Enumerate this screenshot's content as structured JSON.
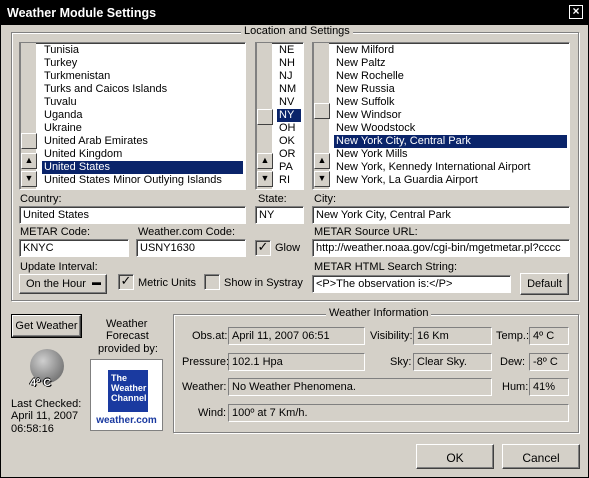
{
  "window": {
    "title": "Weather Module Settings",
    "close_glyph": "×"
  },
  "location": {
    "group_title": "Location and Settings",
    "countries": [
      "Tunisia",
      "Turkey",
      "Turkmenistan",
      "Turks and Caicos Islands",
      "Tuvalu",
      "Uganda",
      "Ukraine",
      "United Arab Emirates",
      "United Kingdom",
      "United States",
      "United States Minor Outlying Islands"
    ],
    "selected_country_index": 9,
    "states": [
      "NE",
      "NH",
      "NJ",
      "NM",
      "NV",
      "NY",
      "OH",
      "OK",
      "OR",
      "PA",
      "RI"
    ],
    "selected_state_index": 5,
    "cities": [
      "New Milford",
      "New Paltz",
      "New Rochelle",
      "New Russia",
      "New Suffolk",
      "New Windsor",
      "New Woodstock",
      "New York City, Central Park",
      "New York Mills",
      "New York, Kennedy International Airport",
      "New York, La Guardia Airport"
    ],
    "selected_city_index": 7,
    "country_label": "Country:",
    "country_value": "United States",
    "state_label": "State:",
    "state_value": "NY",
    "city_label": "City:",
    "city_value": "New York City, Central Park",
    "metar_code_label": "METAR Code:",
    "metar_code_value": "KNYC",
    "weather_com_code_label": "Weather.com Code:",
    "weather_com_code_value": "USNY1630",
    "glow_label": "Glow",
    "glow_checked": true,
    "metar_source_label": "METAR Source URL:",
    "metar_source_value": "http://weather.noaa.gov/cgi-bin/mgetmetar.pl?cccc",
    "update_interval_label": "Update Interval:",
    "update_interval_value": "On the Hour",
    "metric_units_label": "Metric Units",
    "metric_units_checked": true,
    "show_in_systray_label": "Show in Systray",
    "show_in_systray_checked": false,
    "metar_html_search_label": "METAR HTML Search String:",
    "metar_html_search_value": "<P>The observation is:</P>",
    "default_button": "Default"
  },
  "left_panel": {
    "get_weather_button": "Get Weather",
    "forecast_line1": "Weather",
    "forecast_line2": "Forecast",
    "forecast_line3": "provided by:",
    "logo_line1": "The",
    "logo_line2": "Weather",
    "logo_line3": "Channel",
    "logo_url": "weather.com",
    "temperature": "4º C",
    "last_checked_label": "Last Checked:",
    "last_checked_date": "April 11, 2007",
    "last_checked_time": "06:58:16"
  },
  "weather_info": {
    "group_title": "Weather Information",
    "obs_at_label": "Obs.at:",
    "obs_at_value": "April 11, 2007 06:51",
    "visibility_label": "Visibility:",
    "visibility_value": "16 Km",
    "temp_label": "Temp.:",
    "temp_value": "4º C",
    "pressure_label": "Pressure:",
    "pressure_value": "102.1 Hpa",
    "sky_label": "Sky:",
    "sky_value": "Clear Sky.",
    "dew_label": "Dew:",
    "dew_value": "-8º C",
    "weather_label": "Weather:",
    "weather_value": "No Weather Phenomena.",
    "hum_label": "Hum:",
    "hum_value": "41%",
    "wind_label": "Wind:",
    "wind_value": "100º at 7 Km/h."
  },
  "footer": {
    "ok_button": "OK",
    "cancel_button": "Cancel"
  }
}
